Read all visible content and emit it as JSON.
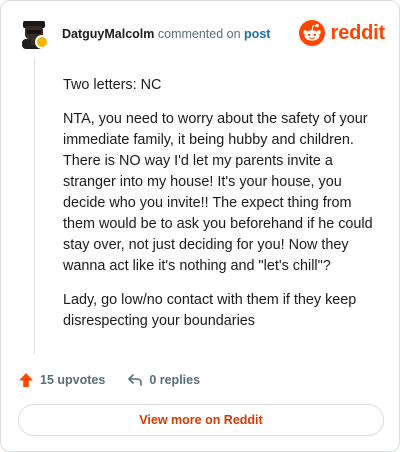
{
  "header": {
    "username": "DatguyMalcolm",
    "commented_text": "commented on",
    "post_link": "post",
    "brand_name": "reddit",
    "brand_color": "#ff4500"
  },
  "comment": {
    "paragraphs": [
      "Two letters: NC",
      "NTA, you need to worry about the safety of your immediate family, it being hubby and children. There is NO way I'd let my parents invite a stranger into my house! It's your house, you decide who you invite!! The expect thing from them would be to ask you beforehand if he could stay over, not just deciding for you! Now they wanna act like it's nothing and \"let's chill\"?",
      "Lady, go low/no contact with them if they keep disrespecting your boundaries"
    ]
  },
  "actions": {
    "upvotes_label": "15 upvotes",
    "replies_label": "0 replies",
    "upvote_icon": "upvote-arrow-icon",
    "reply_icon": "reply-arrow-icon",
    "upvote_color": "#ff4500"
  },
  "footer": {
    "view_more_label": "View more on Reddit",
    "view_more_color": "#d93a00"
  }
}
